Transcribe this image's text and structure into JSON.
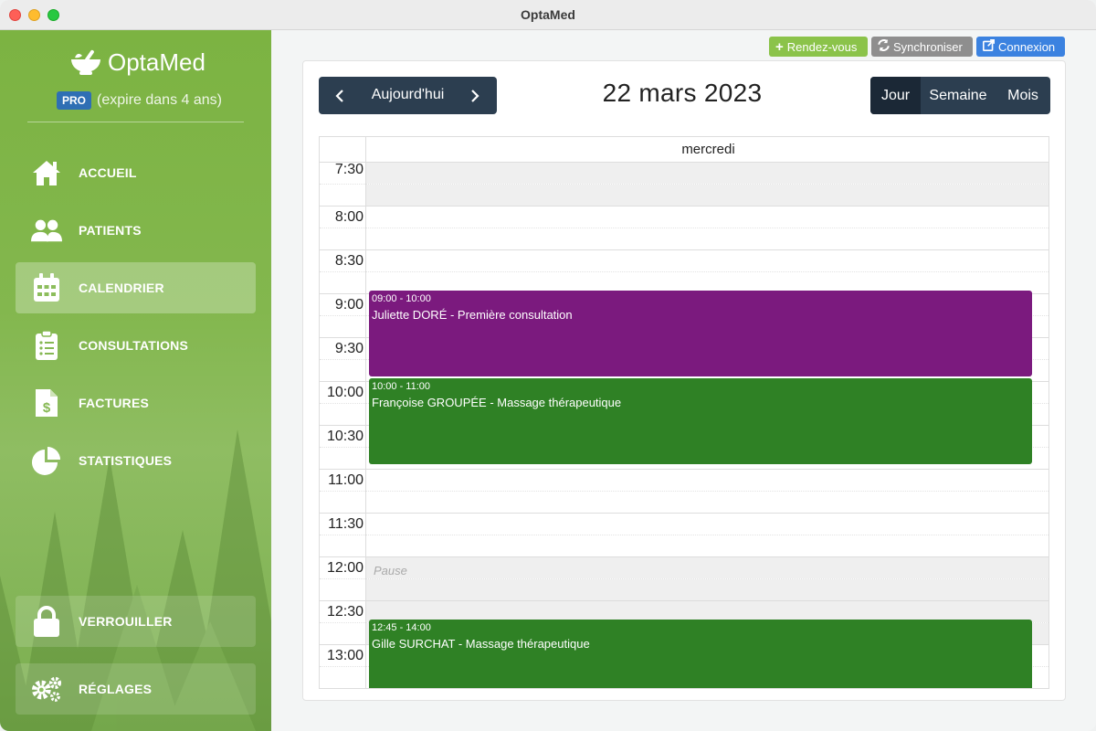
{
  "window": {
    "title": "OptaMed"
  },
  "sidebar": {
    "brand": "OptaMed",
    "pro_badge": "PRO",
    "pro_text": "(expire dans 4 ans)",
    "items": [
      {
        "label": "ACCUEIL",
        "icon": "home-icon"
      },
      {
        "label": "PATIENTS",
        "icon": "users-icon"
      },
      {
        "label": "CALENDRIER",
        "icon": "calendar-icon",
        "active": true
      },
      {
        "label": "CONSULTATIONS",
        "icon": "clipboard-list-icon"
      },
      {
        "label": "FACTURES",
        "icon": "invoice-dollar-icon"
      },
      {
        "label": "STATISTIQUES",
        "icon": "pie-chart-icon"
      }
    ],
    "lock": {
      "label": "VERROUILLER",
      "icon": "lock-icon"
    },
    "settings": {
      "label": "RÉGLAGES",
      "icon": "gears-icon"
    }
  },
  "toolbar": {
    "rdv_label": "Rendez-vous",
    "sync_label": "Synchroniser",
    "connexion_label": "Connexion"
  },
  "calendar": {
    "today_label": "Aujourd'hui",
    "date_title": "22 mars 2023",
    "views": {
      "day": "Jour",
      "week": "Semaine",
      "month": "Mois",
      "active": "Jour"
    },
    "day_name": "mercredi",
    "pause_label": "Pause",
    "times": [
      "7:30",
      "8:00",
      "8:30",
      "9:00",
      "9:30",
      "10:00",
      "10:30",
      "11:00",
      "11:30",
      "12:00",
      "12:30",
      "13:00"
    ],
    "events": [
      {
        "time": "09:00 - 10:00",
        "title": "Juliette DORÉ - Première consultation",
        "color": "#7b1a7e"
      },
      {
        "time": "10:00 - 11:00",
        "title": "Françoise GROUPÉE - Massage thérapeutique",
        "color": "#2f8125"
      },
      {
        "time": "12:45 - 14:00",
        "title": "Gille SURCHAT - Massage thérapeutique",
        "color": "#2f8125"
      }
    ]
  },
  "colors": {
    "sidebar_green": "#7cb342",
    "nav_dark": "#2c3e50",
    "accent_green": "#8bc34a",
    "accent_blue": "#3b82e0"
  }
}
